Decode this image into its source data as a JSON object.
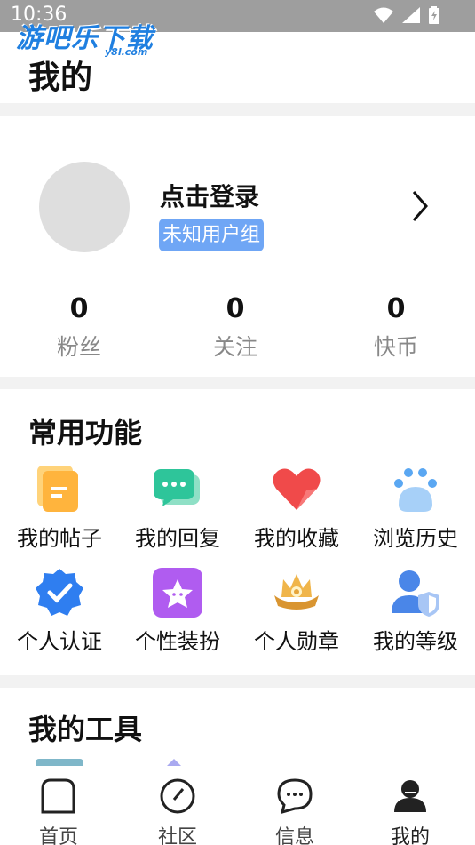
{
  "status_bar": {
    "time": "10:36"
  },
  "watermark": {
    "text": "游吧乐下载",
    "sub": "y8l.com"
  },
  "header": {
    "title": "我的"
  },
  "profile": {
    "login_text": "点击登录",
    "group_badge": "未知用户组",
    "stats": [
      {
        "value": "0",
        "label": "粉丝"
      },
      {
        "value": "0",
        "label": "关注"
      },
      {
        "value": "0",
        "label": "快币"
      }
    ]
  },
  "common_functions": {
    "title": "常用功能",
    "items": [
      {
        "label": "我的帖子",
        "icon": "document-icon",
        "color": "#ffb43d"
      },
      {
        "label": "我的回复",
        "icon": "chat-icon",
        "color": "#2ec59a"
      },
      {
        "label": "我的收藏",
        "icon": "heart-icon",
        "color": "#f04a4a"
      },
      {
        "label": "浏览历史",
        "icon": "paw-icon",
        "color": "#5aa7f2"
      },
      {
        "label": "个人认证",
        "icon": "verified-badge-icon",
        "color": "#2f7ef0"
      },
      {
        "label": "个性装扮",
        "icon": "star-face-icon",
        "color": "#b05cf0"
      },
      {
        "label": "个人勋章",
        "icon": "crown-medal-icon",
        "color": "#e6a53a"
      },
      {
        "label": "我的等级",
        "icon": "user-shield-icon",
        "color": "#4a86e8"
      }
    ]
  },
  "tools": {
    "title": "我的工具"
  },
  "tab_bar": {
    "tabs": [
      {
        "label": "首页",
        "icon": "home-icon"
      },
      {
        "label": "社区",
        "icon": "compass-icon"
      },
      {
        "label": "信息",
        "icon": "message-icon"
      },
      {
        "label": "我的",
        "icon": "profile-icon",
        "active": true
      }
    ]
  }
}
